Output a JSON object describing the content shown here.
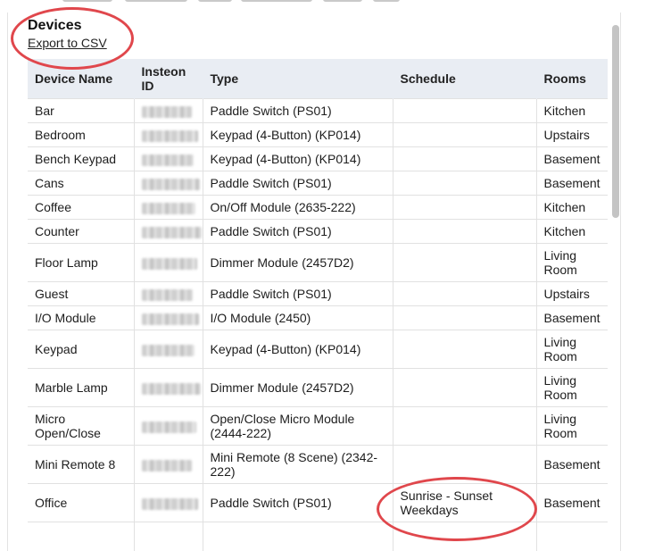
{
  "section": {
    "title": "Devices",
    "export_label": "Export to CSV"
  },
  "table": {
    "headers": {
      "device_name": "Device Name",
      "insteon_id_line1": "Insteon",
      "insteon_id_line2": "ID",
      "type": "Type",
      "schedule": "Schedule",
      "rooms": "Rooms"
    },
    "rows": [
      {
        "name": "Bar",
        "type": "Paddle Switch (PS01)",
        "schedule": "",
        "room": "Kitchen"
      },
      {
        "name": "Bedroom",
        "type": "Keypad (4-Button) (KP014)",
        "schedule": "",
        "room": "Upstairs"
      },
      {
        "name": "Bench Keypad",
        "type": "Keypad (4-Button) (KP014)",
        "schedule": "",
        "room": "Basement"
      },
      {
        "name": "Cans",
        "type": "Paddle Switch (PS01)",
        "schedule": "",
        "room": "Basement"
      },
      {
        "name": "Coffee",
        "type": "On/Off Module (2635-222)",
        "schedule": "",
        "room": "Kitchen"
      },
      {
        "name": "Counter",
        "type": "Paddle Switch (PS01)",
        "schedule": "",
        "room": "Kitchen"
      },
      {
        "name": "Floor Lamp",
        "type": "Dimmer Module (2457D2)",
        "schedule": "",
        "room": "Living Room"
      },
      {
        "name": "Guest",
        "type": "Paddle Switch (PS01)",
        "schedule": "",
        "room": "Upstairs"
      },
      {
        "name": "I/O Module",
        "type": "I/O Module (2450)",
        "schedule": "",
        "room": "Basement"
      },
      {
        "name": "Keypad",
        "type": "Keypad (4-Button) (KP014)",
        "schedule": "",
        "room": "Living Room"
      },
      {
        "name": "Marble Lamp",
        "type": "Dimmer Module (2457D2)",
        "schedule": "",
        "room": "Living Room"
      },
      {
        "name": "Micro Open/Close",
        "type": "Open/Close Micro Module (2444-222)",
        "schedule": "",
        "room": "Living Room"
      },
      {
        "name": "Mini Remote 8",
        "type": "Mini Remote (8 Scene) (2342-222)",
        "schedule": "",
        "room": "Basement"
      },
      {
        "name": "Office",
        "type": "Paddle Switch (PS01)",
        "schedule": "Sunrise - Sunset Weekdays",
        "room": "Basement"
      },
      {
        "name": "",
        "type": "",
        "schedule": "",
        "room": ""
      }
    ]
  },
  "colors": {
    "header_bg": "#e9edf3",
    "highlight_circle": "#e0474c",
    "row_border": "#e1e1e1"
  }
}
